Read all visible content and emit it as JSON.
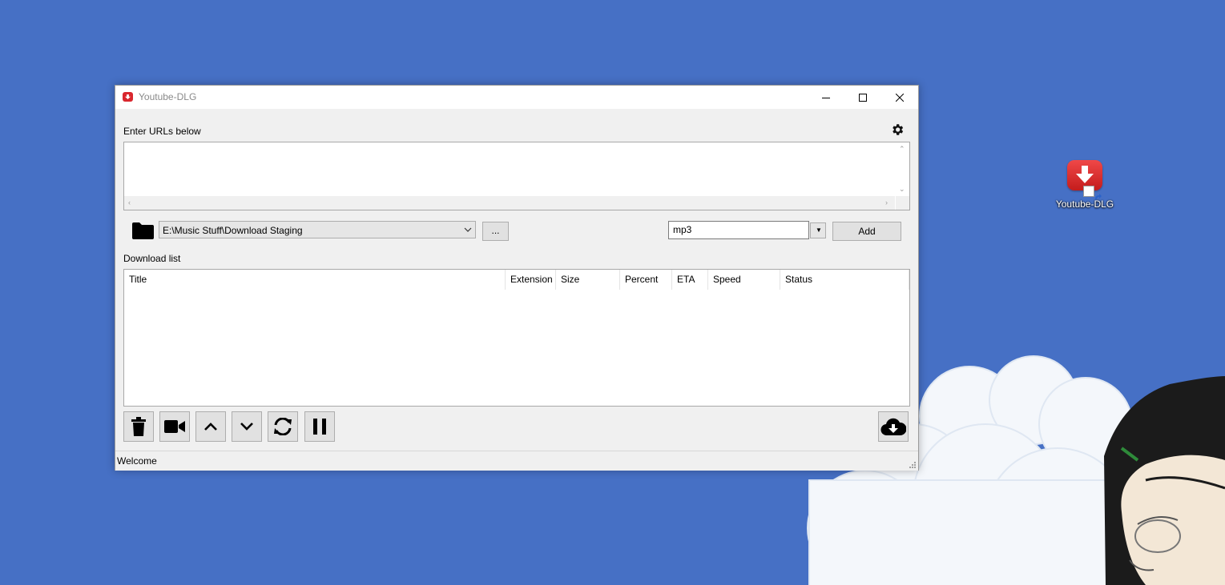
{
  "window": {
    "title": "Youtube-DLG",
    "app_icon": "youtube-dlg-icon",
    "controls": [
      "minimize-icon",
      "maximize-icon",
      "close-icon"
    ]
  },
  "urls": {
    "label": "Enter URLs below",
    "value": "",
    "settings_icon": "gear-icon"
  },
  "path": {
    "folder_icon": "folder-icon",
    "value": "E:\\Music Stuff\\Download Staging",
    "browse_label": "..."
  },
  "format": {
    "value": "mp3",
    "add_label": "Add"
  },
  "download_list": {
    "label": "Download list",
    "columns": [
      "Title",
      "Extension",
      "Size",
      "Percent",
      "ETA",
      "Speed",
      "Status"
    ],
    "rows": []
  },
  "toolbar": {
    "buttons": [
      "trash-icon",
      "video-camera-icon",
      "chevron-up-icon",
      "chevron-down-icon",
      "refresh-icon",
      "pause-icon"
    ],
    "download_icon": "cloud-download-icon"
  },
  "status": {
    "text": "Welcome"
  },
  "desktop": {
    "icon_label": "Youtube-DLG",
    "background_color": "#4670c5"
  }
}
